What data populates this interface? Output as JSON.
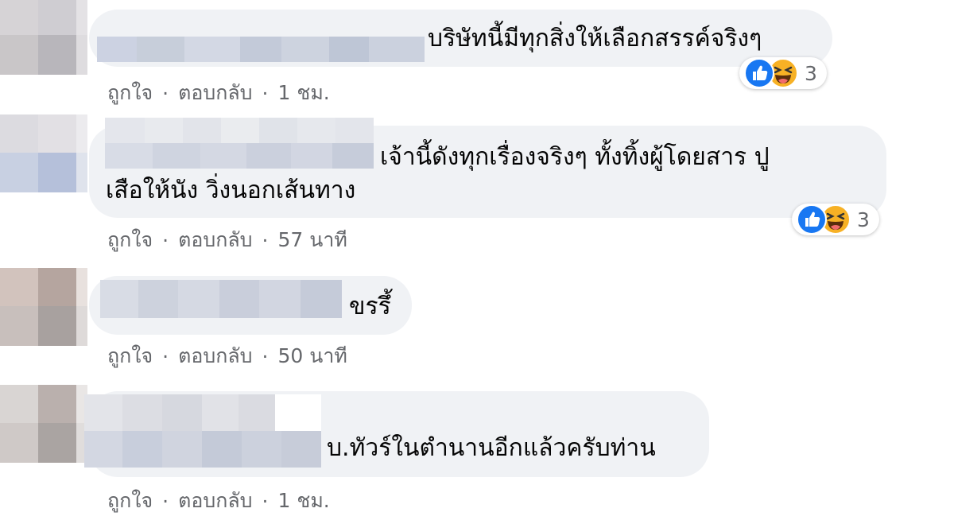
{
  "colors": {
    "bubble_bg": "#f0f2f5",
    "meta_text": "#65676b",
    "like_blue": "#1877f2",
    "haha_yellow": "#f7b125"
  },
  "comments": [
    {
      "text_lines": [
        "บริษัทนี้มีทุกสิ่งให้เลือกสรรค์จริงๆ"
      ],
      "reaction_icons": [
        "like-icon",
        "haha-icon"
      ],
      "reaction_count": "3",
      "actions": {
        "like": "ถูกใจ",
        "reply": "ตอบกลับ",
        "time": "1 ชม."
      }
    },
    {
      "text_lines": [
        "เจ้านี้ดังทุกเรื่องจริงๆ ทั้งทิ้งผู้โดยสาร ปู",
        "เสือให้นัง วิ่งนอกเส้นทาง"
      ],
      "reaction_icons": [
        "like-icon",
        "haha-icon"
      ],
      "reaction_count": "3",
      "actions": {
        "like": "ถูกใจ",
        "reply": "ตอบกลับ",
        "time": "57 นาที"
      }
    },
    {
      "text_lines": [
        "ขรรึ้"
      ],
      "actions": {
        "like": "ถูกใจ",
        "reply": "ตอบกลับ",
        "time": "50 นาที"
      }
    },
    {
      "text_lines": [
        "บ.ทัวร์ในตำนานอีกแล้วครับท่าน"
      ],
      "actions": {
        "like": "ถูกใจ",
        "reply": "ตอบกลับ",
        "time": "1 ชม."
      }
    }
  ],
  "separator": "·"
}
